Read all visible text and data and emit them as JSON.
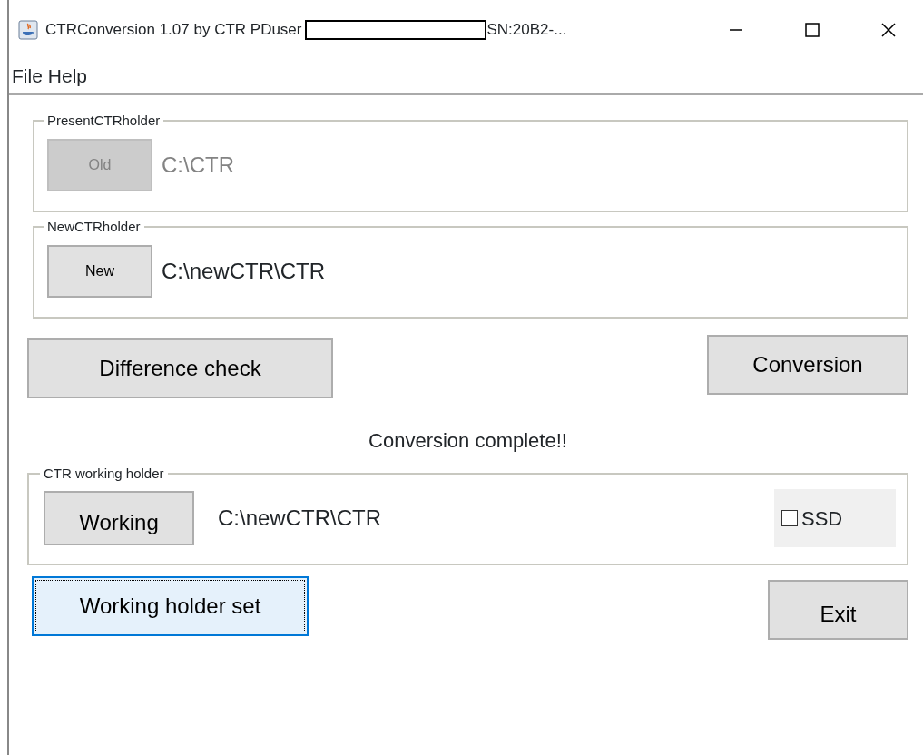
{
  "window": {
    "title": "CTRConversion 1.07 by CTR PDuser",
    "serial": "SN:20B2-..."
  },
  "menu": [
    {
      "label": "File"
    },
    {
      "label": "Help"
    }
  ],
  "present_holder": {
    "legend": "PresentCTRholder",
    "button": {
      "label": "Old",
      "disabled": true
    },
    "path": "C:\\CTR",
    "path_disabled": true
  },
  "new_holder": {
    "legend": "NewCTRholder",
    "button": {
      "label": "New",
      "disabled": false
    },
    "path": "C:\\newCTR\\CTR",
    "path_disabled": false
  },
  "difference_button": {
    "label": "Difference check"
  },
  "conversion_button": {
    "label": "Conversion"
  },
  "status": "Conversion complete!!",
  "working_holder": {
    "legend": "CTR working holder",
    "button": {
      "label": "Working"
    },
    "path": "C:\\newCTR\\CTR",
    "ssd": {
      "label": "SSD",
      "checked": false
    }
  },
  "set_button": {
    "label": "Working holder set",
    "focused": true
  },
  "exit_button": {
    "label": "Exit"
  }
}
